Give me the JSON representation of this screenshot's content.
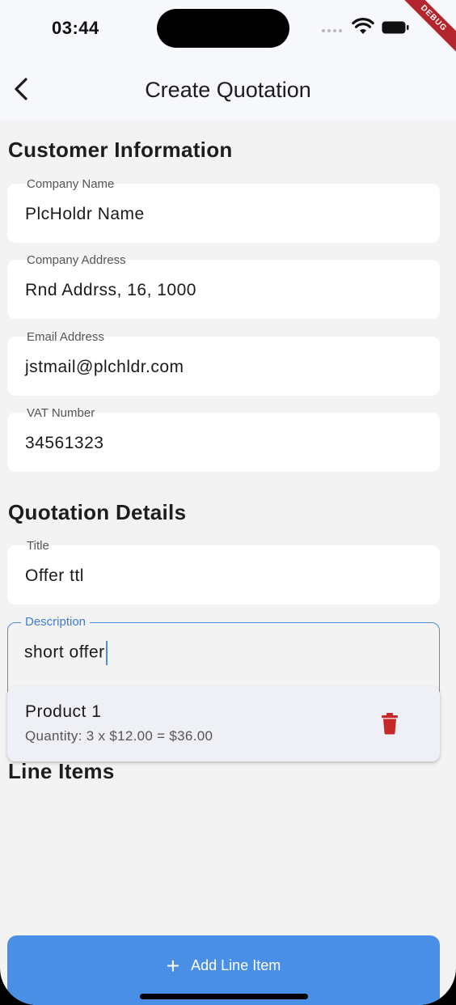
{
  "status_bar": {
    "time": "03:44",
    "debug_label": "DEBUG"
  },
  "app_bar": {
    "title": "Create Quotation",
    "back_icon": "chevron-left-icon"
  },
  "customer": {
    "heading": "Customer Information",
    "company_name": {
      "label": "Company Name",
      "value": "PlcHoldr Name"
    },
    "company_address": {
      "label": "Company Address",
      "value": "Rnd Addrss, 16, 1000"
    },
    "email": {
      "label": "Email Address",
      "value": "jstmail@plchldr.com"
    },
    "vat": {
      "label": "VAT Number",
      "value": "34561323"
    }
  },
  "quotation": {
    "heading": "Quotation Details",
    "title": {
      "label": "Title",
      "value": "Offer ttl"
    },
    "description": {
      "label": "Description",
      "value": "short offer"
    }
  },
  "line_items": {
    "heading": "Line Items",
    "items": [
      {
        "name": "Product 1",
        "detail": "Quantity: 3 x $12.00 = $36.00",
        "delete_icon": "trash-icon"
      }
    ]
  },
  "actions": {
    "add_line_item": "Add Line Item",
    "add_icon": "plus-icon"
  },
  "colors": {
    "accent": "#4a8fe6",
    "delete": "#c62828",
    "background": "#f3f3f3"
  }
}
